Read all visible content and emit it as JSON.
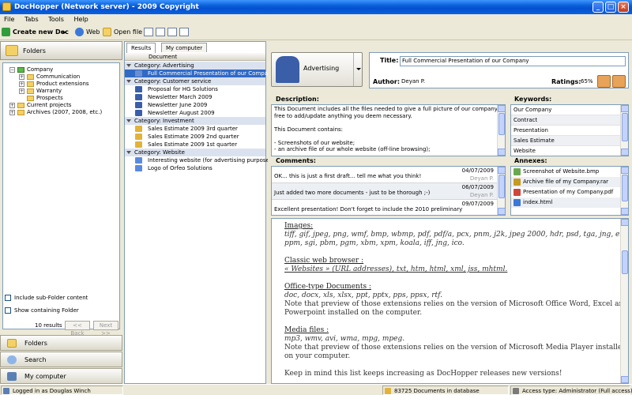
{
  "window": {
    "title": "DocHopper (Network server) - 2009 Copyright"
  },
  "menu": [
    "File",
    "Tabs",
    "Tools",
    "Help"
  ],
  "toolbar": {
    "create": "Create new Doc",
    "web": "Web",
    "open": "Open file"
  },
  "left": {
    "header": "Folders",
    "tree": [
      {
        "label": "Company",
        "level": 0,
        "expander": "-"
      },
      {
        "label": "Communication",
        "level": 1,
        "expander": "+"
      },
      {
        "label": "Product extensions",
        "level": 1,
        "expander": "+"
      },
      {
        "label": "Warranty",
        "level": 1,
        "expander": "+"
      },
      {
        "label": "Prospects",
        "level": 1,
        "expander": ""
      },
      {
        "label": "Current projects",
        "level": 0,
        "expander": "+"
      },
      {
        "label": "Archives (2007, 2008, etc.)",
        "level": 0,
        "expander": "+"
      }
    ],
    "include_sub": "Include sub-Folder content",
    "show_containing": "Show containing Folder",
    "results_count": "10 results",
    "back": "<< Back",
    "next": "Next >>",
    "nav_folders": "Folders",
    "nav_search": "Search",
    "nav_computer": "My computer"
  },
  "results": {
    "tabs": [
      "Results",
      "My computer"
    ],
    "column": "Document",
    "rows": [
      {
        "type": "category",
        "label": "Category:  Advertising"
      },
      {
        "type": "doc",
        "label": "Full Commercial Presentation of our Company",
        "icon": "doc",
        "selected": true
      },
      {
        "type": "category",
        "label": "Category:  Customer service"
      },
      {
        "type": "doc",
        "label": "Proposal for HG Solutions",
        "icon": "person"
      },
      {
        "type": "doc",
        "label": "Newsletter March 2009",
        "icon": "person"
      },
      {
        "type": "doc",
        "label": "Newsletter June 2009",
        "icon": "person"
      },
      {
        "type": "doc",
        "label": "Newsletter August 2009",
        "icon": "person"
      },
      {
        "type": "category",
        "label": "Category:  Investment"
      },
      {
        "type": "doc",
        "label": "Sales Estimate 2009 3rd quarter",
        "icon": "coin"
      },
      {
        "type": "doc",
        "label": "Sales Estimate 2009 2nd quarter",
        "icon": "coin"
      },
      {
        "type": "doc",
        "label": "Sales Estimate 2009 1st quarter",
        "icon": "coin"
      },
      {
        "type": "category",
        "label": "Category:  Website"
      },
      {
        "type": "doc",
        "label": "Interesting website (for advertising purposes)",
        "icon": "star"
      },
      {
        "type": "doc",
        "label": "Logo of Orfeo Solutions",
        "icon": "star"
      }
    ]
  },
  "doc": {
    "category": "Advertising",
    "title_label": "Title:",
    "title_value": "Full Commercial Presentation of our Company",
    "author_label": "Author:",
    "author_value": "Deyan P.",
    "ratings_label": "Ratings:",
    "ratings_value": "65%",
    "description_label": "Description:",
    "description": [
      "This Document includes all the files needed to give a full picture of our company. Please feel",
      "free to add/update anything you deem necessary.",
      "",
      "This Document contains:",
      "",
      "- Screenshots of our website;",
      "- an archive file of our whole website (off-line browsing);"
    ],
    "keywords_label": "Keywords:",
    "keywords": [
      "Our Company",
      "Contract",
      "Presentation",
      "Sales Estimate",
      "Website"
    ],
    "comments_label": "Comments:",
    "comments": [
      {
        "text": "OK... this is just a first draft... tell me what you think!",
        "date": "04/07/2009",
        "author": "Deyan P."
      },
      {
        "text": "Just added two more documents - just to be thorough ;-)",
        "date": "06/07/2009",
        "author": "Deyan P."
      },
      {
        "text": "Excellent presentation! Don't forget to include the 2010 preliminary",
        "date": "09/07/2009",
        "author": ""
      }
    ],
    "annexes_label": "Annexes:",
    "annexes": [
      {
        "name": "Screenshot of Website.bmp",
        "icon": "image"
      },
      {
        "name": "Archive file of my Company.rar",
        "icon": "archive"
      },
      {
        "name": "Presentation of my Company.pdf",
        "icon": "pdf"
      },
      {
        "name": "index.html",
        "icon": "web"
      }
    ]
  },
  "preview": {
    "lines": [
      {
        "style": "head",
        "text": "Images:"
      },
      {
        "style": "italic",
        "text": "tiff, gif, jpeg, png, wmf, bmp, wbmp, pdf, pdf/a, pcx, pnm, j2k, jpeg 2000, hdr, psd, tga, jng, exr, dds,"
      },
      {
        "style": "italic",
        "text": "ppm, sgi, pbm, pgm, xbm, xpm, koala, iff, jng, ico."
      },
      {
        "style": "gap",
        "text": ""
      },
      {
        "style": "head",
        "text": "Classic web browser :"
      },
      {
        "style": "italic-u",
        "text": "« Websites » (URL addresses), txt, htm, html, xml, jss, mhtml."
      },
      {
        "style": "gap",
        "text": ""
      },
      {
        "style": "head",
        "text": "Office-type Documents :"
      },
      {
        "style": "italic",
        "text": "doc, docx, xls, xlsx, ppt, pptx, pps, ppsx, rtf."
      },
      {
        "style": "plain",
        "text": "Note that preview of those extensions relies on the version of Microsoft Office Word, Excel and"
      },
      {
        "style": "plain",
        "text": "Powerpoint installed on the computer."
      },
      {
        "style": "gap",
        "text": ""
      },
      {
        "style": "head",
        "text": "Media files :"
      },
      {
        "style": "italic",
        "text": "mp3, wmv, avi, wma, mpg, mpeg."
      },
      {
        "style": "plain",
        "text": "Note that preview of those extensions relies on the version of Microsoft Media Player installed"
      },
      {
        "style": "plain",
        "text": "on your computer."
      },
      {
        "style": "gap",
        "text": ""
      },
      {
        "style": "plain",
        "text": "Keep in mind this list keeps increasing as DocHopper releases new versions!"
      }
    ]
  },
  "status": {
    "user": "Logged in as Douglas Winch",
    "docs": "83725 Documents in database",
    "access": "Access type: Administrator (Full access)"
  },
  "colors": {
    "titlebar": "#0a5fd8",
    "selection": "#316ac5",
    "category_row": "#dbe2ef"
  }
}
